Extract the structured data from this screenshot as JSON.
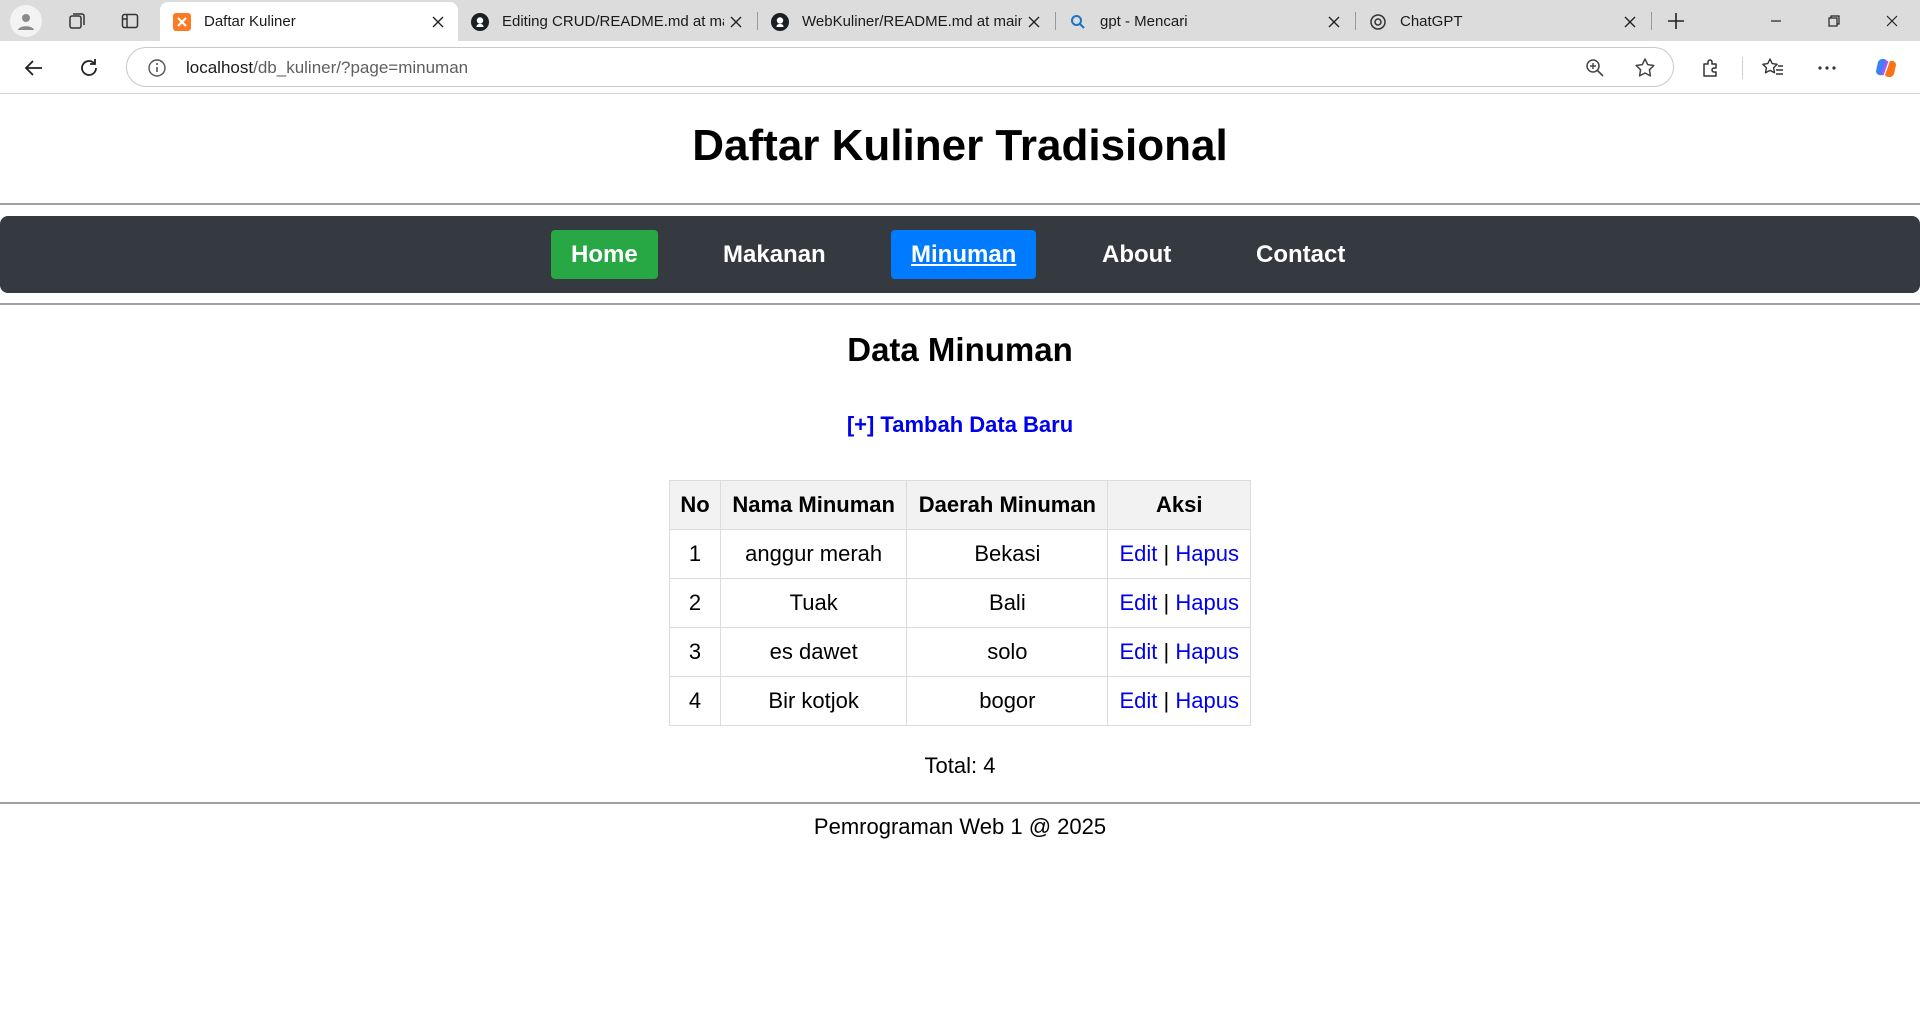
{
  "browser": {
    "tabs": [
      {
        "title": "Daftar Kuliner",
        "icon": "xampp-icon",
        "active": true
      },
      {
        "title": "Editing CRUD/README.md at main",
        "icon": "github-icon",
        "active": false
      },
      {
        "title": "WebKuliner/README.md at main",
        "icon": "github-icon",
        "active": false
      },
      {
        "title": "gpt - Mencari",
        "icon": "search-icon",
        "active": false
      },
      {
        "title": "ChatGPT",
        "icon": "chatgpt-icon",
        "active": false
      }
    ],
    "url_host": "localhost",
    "url_path": "/db_kuliner/?page=minuman"
  },
  "site": {
    "title": "Daftar Kuliner Tradisional",
    "nav": [
      {
        "label": "Home",
        "state": "home",
        "color": "#28a745"
      },
      {
        "label": "Makanan",
        "state": "normal"
      },
      {
        "label": "Minuman",
        "state": "current",
        "color": "#007bff"
      },
      {
        "label": "About",
        "state": "normal"
      },
      {
        "label": "Contact",
        "state": "normal"
      }
    ],
    "nav_bg": "#343a40"
  },
  "main": {
    "heading": "Data Minuman",
    "add_link": "[+] Tambah Data Baru",
    "table": {
      "headers": [
        "No",
        "Nama Minuman",
        "Daerah Minuman",
        "Aksi"
      ],
      "rows": [
        {
          "no": "1",
          "nama": "anggur merah",
          "daerah": "Bekasi",
          "edit": "Edit",
          "sep": "|",
          "hapus": "Hapus"
        },
        {
          "no": "2",
          "nama": "Tuak",
          "daerah": "Bali",
          "edit": "Edit",
          "sep": "|",
          "hapus": "Hapus"
        },
        {
          "no": "3",
          "nama": "es dawet",
          "daerah": "solo",
          "edit": "Edit",
          "sep": "|",
          "hapus": "Hapus"
        },
        {
          "no": "4",
          "nama": "Bir kotjok",
          "daerah": "bogor",
          "edit": "Edit",
          "sep": "|",
          "hapus": "Hapus"
        }
      ]
    },
    "total": "Total: 4"
  },
  "footer": {
    "text": "Pemrograman Web 1 @ 2025"
  }
}
